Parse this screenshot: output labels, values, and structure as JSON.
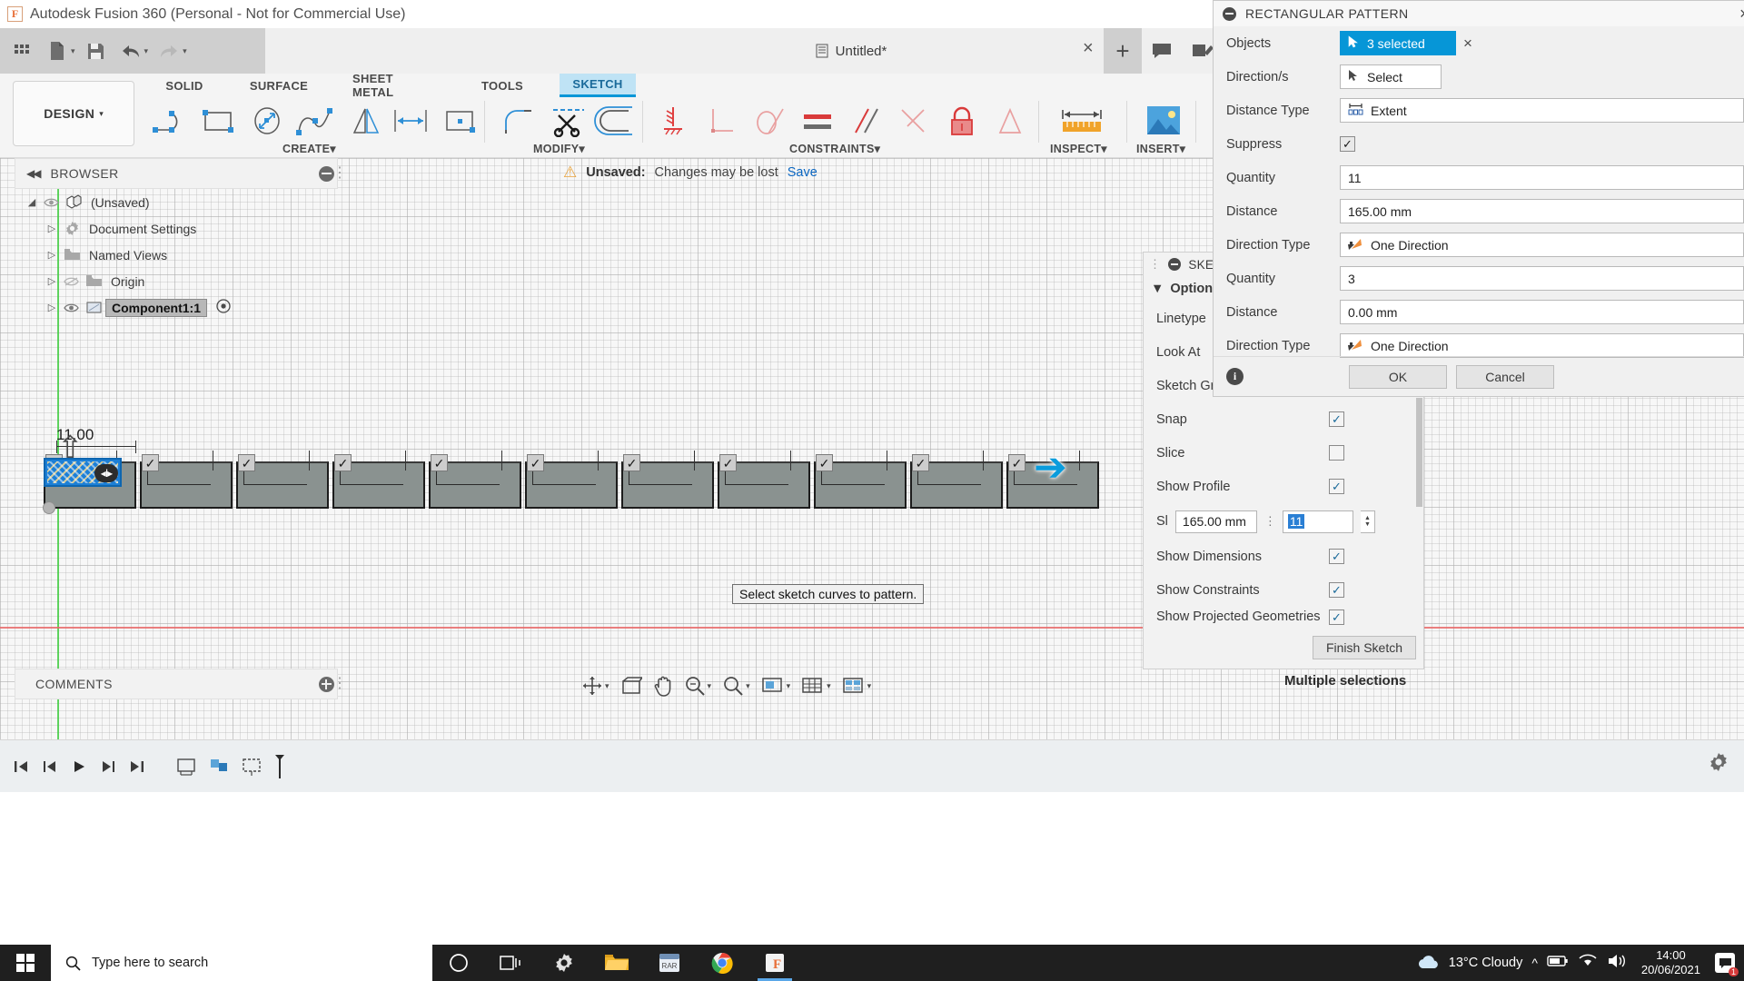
{
  "titlebar": {
    "app_title": "Autodesk Fusion 360 (Personal - Not for Commercial Use)",
    "logo_letter": "F"
  },
  "quick_access": [
    {
      "name": "grid-apps-icon",
      "label": "Show Data Panel"
    },
    {
      "name": "new-file-icon",
      "label": "File"
    },
    {
      "name": "save-icon",
      "label": "Save"
    },
    {
      "name": "undo-icon",
      "label": "Undo"
    },
    {
      "name": "redo-icon",
      "label": "Redo"
    }
  ],
  "document_tab": {
    "title": "Untitled*",
    "close_label": "×",
    "add_label": "+"
  },
  "ribbon": {
    "design_label": "DESIGN",
    "design_caret": "▾",
    "tabs": [
      {
        "label": "SOLID",
        "active": false
      },
      {
        "label": "SURFACE",
        "active": false
      },
      {
        "label": "SHEET METAL",
        "active": false
      },
      {
        "label": "TOOLS",
        "active": false
      },
      {
        "label": "SKETCH",
        "active": true
      }
    ],
    "groups": [
      {
        "label": "CREATE",
        "caret": "▾"
      },
      {
        "label": "MODIFY",
        "caret": "▾"
      },
      {
        "label": "CONSTRAINTS",
        "caret": "▾"
      },
      {
        "label": "INSPECT",
        "caret": "▾"
      },
      {
        "label": "INSERT",
        "caret": "▾"
      }
    ]
  },
  "browser": {
    "title": "BROWSER",
    "collapse_icon": "◀◀",
    "items": [
      {
        "label": "(Unsaved)",
        "icon": "component-icon",
        "expanded": true,
        "selected": false,
        "has_eye": true
      },
      {
        "label": "Document Settings",
        "icon": "gear-icon",
        "expanded": false,
        "selected": false,
        "has_eye": false
      },
      {
        "label": "Named Views",
        "icon": "folder-icon",
        "expanded": false,
        "selected": false,
        "has_eye": false
      },
      {
        "label": "Origin",
        "icon": "folder-icon",
        "expanded": false,
        "selected": false,
        "has_eye": true
      },
      {
        "label": "Component1:1",
        "icon": "component-icon",
        "expanded": false,
        "selected": true,
        "has_eye": true
      }
    ]
  },
  "unsaved_banner": {
    "warning_icon": "⚠",
    "label": "Unsaved:",
    "message": "Changes may be lost",
    "save_link": "Save"
  },
  "canvas": {
    "dimension_value": "11.00",
    "tooltip": "Select sketch curves to pattern.",
    "pattern_count": 11,
    "checkbox_glyph": "✓",
    "arrow_glyph": "➔"
  },
  "comments": {
    "label": "COMMENTS"
  },
  "status": {
    "multiple_selections": "Multiple selections"
  },
  "rectangular_pattern": {
    "title": "RECTANGULAR PATTERN",
    "close_label": "×",
    "rows": [
      {
        "label": "Objects",
        "value": "3 selected",
        "type": "select-active",
        "icon": "cursor-icon"
      },
      {
        "label": "Direction/s",
        "value": "Select",
        "type": "select",
        "icon": "cursor-icon"
      },
      {
        "label": "Distance Type",
        "value": "Extent",
        "type": "dropdown",
        "icon": "extent-icon"
      },
      {
        "label": "Suppress",
        "value": "",
        "type": "checkbox",
        "checked": true
      },
      {
        "label": "Quantity",
        "value": "11",
        "type": "text"
      },
      {
        "label": "Distance",
        "value": "165.00 mm",
        "type": "text"
      },
      {
        "label": "Direction Type",
        "value": "One Direction",
        "type": "dropdown",
        "icon": "direction-icon"
      },
      {
        "label": "Quantity",
        "value": "3",
        "type": "text"
      },
      {
        "label": "Distance",
        "value": "0.00 mm",
        "type": "text"
      },
      {
        "label": "Direction Type",
        "value": "One Direction",
        "type": "dropdown",
        "icon": "direction-icon"
      }
    ],
    "ok_label": "OK",
    "cancel_label": "Cancel",
    "info_label": "i"
  },
  "sketch_palette": {
    "title": "SKETCH PALETTE",
    "section_label": "Options",
    "section_caret": "▼",
    "rows": [
      {
        "label": "Linetype",
        "control": "none"
      },
      {
        "label": "Look At",
        "control": "none"
      },
      {
        "label": "Sketch Grid",
        "control": "checkbox",
        "checked": true
      },
      {
        "label": "Snap",
        "control": "checkbox",
        "checked": true
      },
      {
        "label": "Slice",
        "control": "checkbox",
        "checked": false
      },
      {
        "label": "Show Profile",
        "control": "checkbox",
        "checked": true
      },
      {
        "label": "Show Dimensions",
        "control": "checkbox",
        "checked": true
      },
      {
        "label": "Show Constraints",
        "control": "checkbox",
        "checked": true
      },
      {
        "label": "Show Projected Geometries",
        "control": "checkbox",
        "checked": true
      }
    ],
    "spinner": {
      "label_prefix": "Sl",
      "distance_value": "165.00 mm",
      "quantity_value": "11",
      "dots": "⋮"
    },
    "finish_label": "Finish Sketch",
    "checkbox_glyph": "✓"
  },
  "taskbar": {
    "search_placeholder": "Type here to search",
    "weather": "13°C  Cloudy",
    "time": "14:00",
    "date": "20/06/2021",
    "notification_count": "1",
    "apps": [
      {
        "name": "cortana-icon",
        "glyph": "○"
      },
      {
        "name": "task-view-icon",
        "glyph": "❑"
      },
      {
        "name": "settings-icon",
        "glyph": "⚙"
      },
      {
        "name": "file-explorer-icon",
        "glyph": "🗀"
      },
      {
        "name": "winrar-icon",
        "glyph": "RAR"
      },
      {
        "name": "chrome-icon",
        "glyph": "◉"
      },
      {
        "name": "fusion360-icon",
        "glyph": "F"
      }
    ]
  }
}
